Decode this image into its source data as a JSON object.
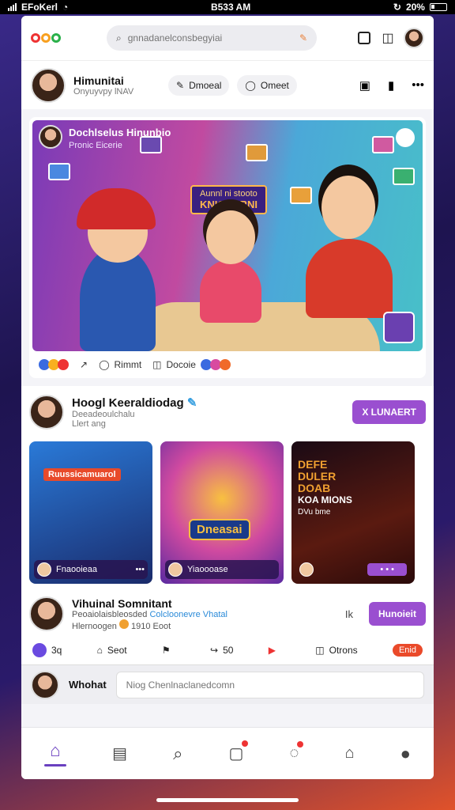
{
  "status_bar": {
    "carrier": "EFoKerl",
    "time": "B533 AM",
    "battery": "20%"
  },
  "top_bar": {
    "search_placeholder": "gnnadanelconsbegyiai",
    "icons": [
      "logo-icon",
      "search-icon",
      "edit-icon",
      "square-icon",
      "chat-icon",
      "avatar"
    ]
  },
  "profile": {
    "name": "Himunitai",
    "subtitle": "Onyuyvpy lNAV",
    "button_1": "Dmoeal",
    "button_2": "Omeet"
  },
  "post": {
    "author": "Dochlselus Hinunbio",
    "subtitle": "Pronic Eicerie",
    "banner_line_1": "Aunnl ni stooto",
    "banner_line_2": "KNIGENRNI",
    "reaction_count": "",
    "action_share": "Rimmt",
    "action_comment": "Docoie"
  },
  "section": {
    "title": "Hoogl Keeraldiodag",
    "subtitle_1": "Deeadeoulchalu",
    "subtitle_2": "Llert ang",
    "button": "X LUNAERT",
    "cards": [
      {
        "label": "Ruussicamuarol",
        "caption": "Fnaooieaa",
        "caption_right": "•••"
      },
      {
        "label": "Dneasai",
        "caption": "Yiaoooase"
      },
      {
        "label_line_1": "DEFE",
        "label_line_2": "DULER",
        "label_line_3": "DOAB",
        "label_line_4": "KOA MIONS",
        "label_line_5": "DVu bme",
        "caption": "• • •"
      }
    ]
  },
  "user_row": {
    "name": "Vihuinal Somnitant",
    "line_2": "Peoaiolaisbleosded",
    "line_2_link": "Colcloonevre Vhatal",
    "line_3": "Hlernoogen",
    "line_3_count": "1910",
    "line_3_tail": "Eoot",
    "button": "Hunoieit",
    "side_icons": "Ik"
  },
  "actions": [
    {
      "label": "3q"
    },
    {
      "label": "Seot"
    },
    {
      "label": ""
    },
    {
      "label": "50"
    },
    {
      "label": ""
    },
    {
      "label": "Otrons"
    },
    {
      "label": "Enid"
    }
  ],
  "comment": {
    "user": "Whohat",
    "placeholder": "Niog Chenlnaclanedcomn"
  },
  "tabs": [
    "home",
    "news",
    "search",
    "notifications",
    "messages",
    "community",
    "profile"
  ],
  "colors": {
    "accent": "#9a4fd0",
    "tab_active": "#6a40c0",
    "badge": "#ea4a2a"
  }
}
